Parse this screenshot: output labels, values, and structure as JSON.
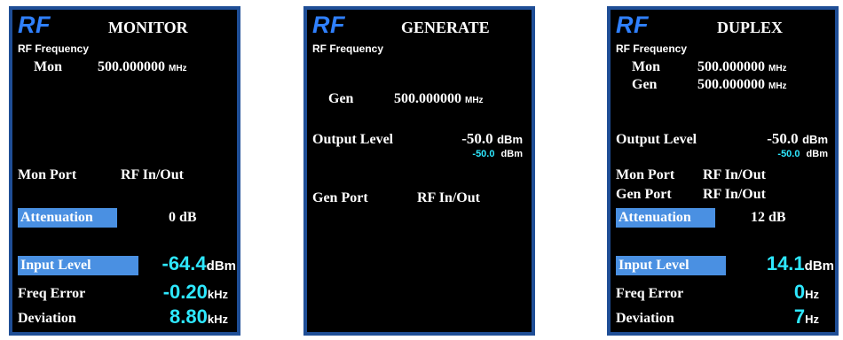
{
  "colors": {
    "panel_bg": "#000000",
    "border": "#1f4e96",
    "accent_cyan": "#2ee8ff",
    "rf_logo": "#2f80ff",
    "highlight": "#4a90e2"
  },
  "panels": [
    {
      "logo": "RF",
      "title": "MONITOR",
      "subtitle": "RF Frequency",
      "mon_label": "Mon",
      "mon_value": "500.000000",
      "mon_unit": "MHz",
      "port_label": "Mon Port",
      "port_value": "RF In/Out",
      "atten_label": "Attenuation",
      "atten_value": "0 dB",
      "input_label": "Input Level",
      "input_value": "-64.4",
      "input_unit": "dBm",
      "freq_error_label": "Freq Error",
      "freq_error_value": "-0.20",
      "freq_error_unit": "kHz",
      "deviation_label": "Deviation",
      "deviation_value": "8.80",
      "deviation_unit": "kHz"
    },
    {
      "logo": "RF",
      "title": "GENERATE",
      "subtitle": "RF Frequency",
      "gen_label": "Gen",
      "gen_value": "500.000000",
      "gen_unit": "MHz",
      "output_label": "Output Level",
      "output_value": "-50.0",
      "output_unit": "dBm",
      "output_value2": "-50.0",
      "output_unit2": "dBm",
      "port_label": "Gen Port",
      "port_value": "RF In/Out"
    },
    {
      "logo": "RF",
      "title": "DUPLEX",
      "subtitle": "RF Frequency",
      "mon_label": "Mon",
      "mon_value": "500.000000",
      "mon_unit": "MHz",
      "gen_label": "Gen",
      "gen_value": "500.000000",
      "gen_unit": "MHz",
      "output_label": "Output Level",
      "output_value": "-50.0",
      "output_unit": "dBm",
      "output_value2": "-50.0",
      "output_unit2": "dBm",
      "mon_port_label": "Mon Port",
      "mon_port_value": "RF In/Out",
      "gen_port_label": "Gen Port",
      "gen_port_value": "RF In/Out",
      "atten_label": "Attenuation",
      "atten_value": "12 dB",
      "input_label": "Input Level",
      "input_value": "14.1",
      "input_unit": "dBm",
      "freq_error_label": "Freq Error",
      "freq_error_value": "0",
      "freq_error_unit": "Hz",
      "deviation_label": "Deviation",
      "deviation_value": "7",
      "deviation_unit": "Hz"
    }
  ]
}
